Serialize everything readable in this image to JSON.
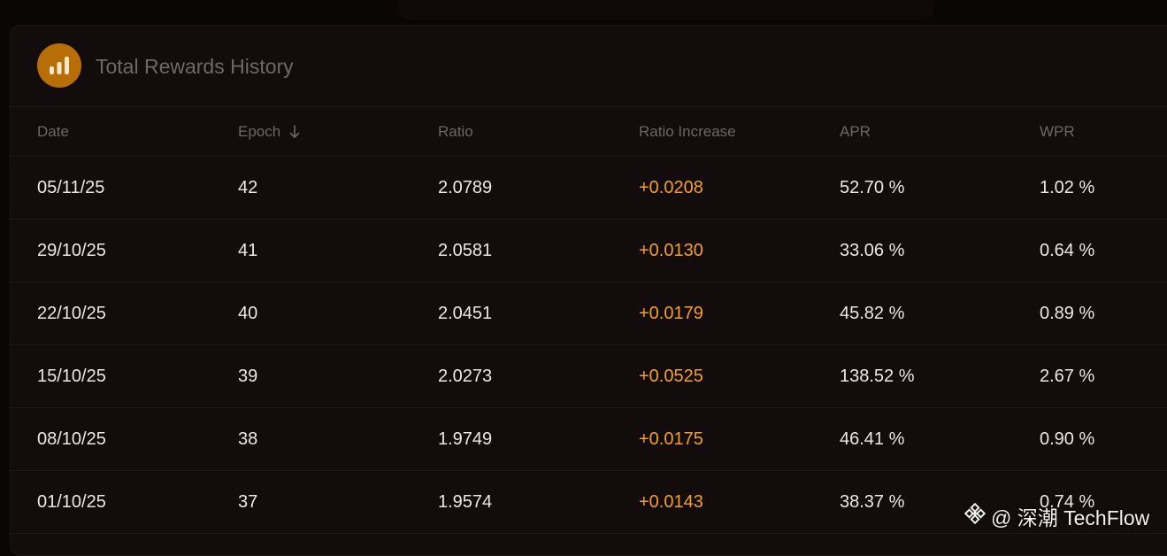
{
  "card": {
    "title": "Total Rewards History",
    "icon": "bar-chart-icon"
  },
  "table": {
    "headers": {
      "date": "Date",
      "epoch": "Epoch",
      "ratio": "Ratio",
      "ratio_increase": "Ratio Increase",
      "apr": "APR",
      "wpr": "WPR"
    },
    "sort_icon": "arrow-down-icon",
    "rows": [
      {
        "date": "05/11/25",
        "epoch": "42",
        "ratio": "2.0789",
        "ratio_increase": "+0.0208",
        "apr": "52.70 %",
        "wpr": "1.02 %"
      },
      {
        "date": "29/10/25",
        "epoch": "41",
        "ratio": "2.0581",
        "ratio_increase": "+0.0130",
        "apr": "33.06 %",
        "wpr": "0.64 %"
      },
      {
        "date": "22/10/25",
        "epoch": "40",
        "ratio": "2.0451",
        "ratio_increase": "+0.0179",
        "apr": "45.82 %",
        "wpr": "0.89 %"
      },
      {
        "date": "15/10/25",
        "epoch": "39",
        "ratio": "2.0273",
        "ratio_increase": "+0.0525",
        "apr": "138.52 %",
        "wpr": "2.67 %"
      },
      {
        "date": "08/10/25",
        "epoch": "38",
        "ratio": "1.9749",
        "ratio_increase": "+0.0175",
        "apr": "46.41 %",
        "wpr": "0.90 %"
      },
      {
        "date": "01/10/25",
        "epoch": "37",
        "ratio": "1.9574",
        "ratio_increase": "+0.0143",
        "apr": "38.37 %",
        "wpr": "0.74 %"
      }
    ]
  },
  "watermark": {
    "text": "@ 深潮 TechFlow",
    "icon": "binance-logo-icon"
  },
  "colors": {
    "background": "#0a0606",
    "card": "#120c0d",
    "accent": "#f5a022",
    "icon_circle": "#b86e06"
  }
}
